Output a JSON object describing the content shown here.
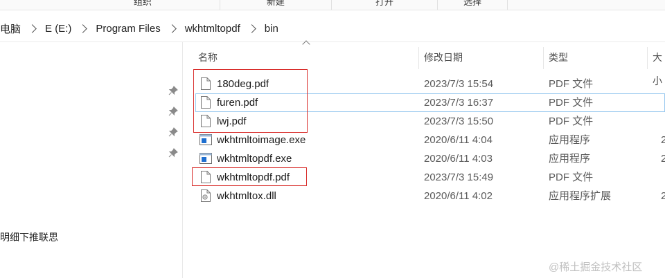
{
  "ribbon": {
    "groups": [
      "组织",
      "新建",
      "打开",
      "选择"
    ]
  },
  "address": {
    "crumbs": [
      "电脑",
      "E (E:)",
      "Program Files",
      "wkhtmltopdf",
      "bin"
    ]
  },
  "nav": {
    "partial_item": "明细下推联思"
  },
  "columns": {
    "name": "名称",
    "date": "修改日期",
    "type": "类型",
    "size": "大小"
  },
  "files": [
    {
      "name": "180deg.pdf",
      "date": "2023/7/3 15:54",
      "type": "PDF 文件",
      "size": "",
      "icon": "document-icon"
    },
    {
      "name": "furen.pdf",
      "date": "2023/7/3 16:37",
      "type": "PDF 文件",
      "size": "",
      "icon": "document-icon"
    },
    {
      "name": "lwj.pdf",
      "date": "2023/7/3 15:50",
      "type": "PDF 文件",
      "size": "",
      "icon": "document-icon"
    },
    {
      "name": "wkhtmltoimage.exe",
      "date": "2020/6/11 4:04",
      "type": "应用程序",
      "size": "2",
      "icon": "application-icon"
    },
    {
      "name": "wkhtmltopdf.exe",
      "date": "2020/6/11 4:03",
      "type": "应用程序",
      "size": "2",
      "icon": "application-icon"
    },
    {
      "name": "wkhtmltopdf.pdf",
      "date": "2023/7/3 15:49",
      "type": "PDF 文件",
      "size": "",
      "icon": "document-icon"
    },
    {
      "name": "wkhtmltox.dll",
      "date": "2020/6/11 4:02",
      "type": "应用程序扩展",
      "size": "2",
      "icon": "dll-icon"
    }
  ],
  "watermark": "@稀土掘金技术社区",
  "colors": {
    "highlight_box": "#d9302e",
    "focus_outline": "#99c9ef",
    "exe_icon_blue": "#1e6fd0"
  }
}
